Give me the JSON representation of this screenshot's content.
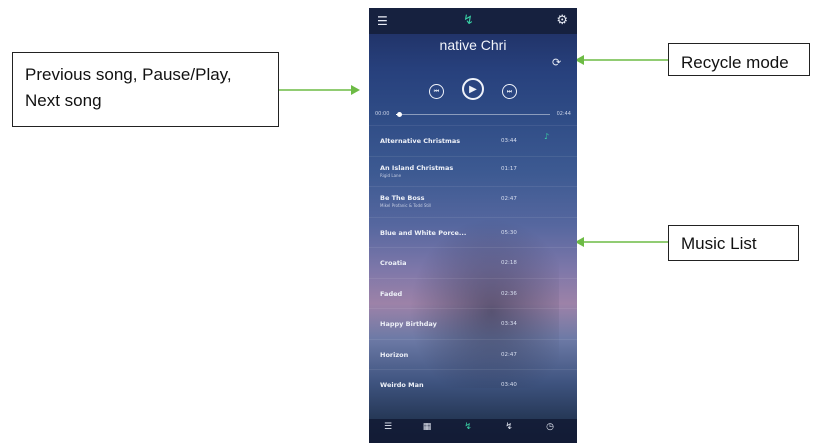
{
  "callouts": {
    "controls": {
      "line1": "Previous song, Pause/Play,",
      "line2": "Next song"
    },
    "recycle": "Recycle mode",
    "music_list": "Music List"
  },
  "player": {
    "title": "native Chri",
    "time_current": "00:00",
    "time_total": "02:44",
    "progress": 0.02
  },
  "songs": [
    {
      "name": "Alternative Christmas",
      "duration": "03:44",
      "sub": ""
    },
    {
      "name": "An Island Christmas",
      "duration": "01:17",
      "sub": "Rigid Lane"
    },
    {
      "name": "Be The Boss",
      "duration": "02:47",
      "sub": "Mikel Profanic & Todd Still"
    },
    {
      "name": "Blue and White Porce...",
      "duration": "05:30",
      "sub": ""
    },
    {
      "name": "Croatia",
      "duration": "02:18",
      "sub": ""
    },
    {
      "name": "Faded",
      "duration": "02:36",
      "sub": ""
    },
    {
      "name": "Happy Birthday",
      "duration": "03:34",
      "sub": ""
    },
    {
      "name": "Horizon",
      "duration": "02:47",
      "sub": ""
    },
    {
      "name": "Weirdo Man",
      "duration": "03:40",
      "sub": ""
    }
  ],
  "colors": {
    "accent": "#39d3a6",
    "arrow": "#6dbb45"
  },
  "icons": {
    "menu": "menu-icon",
    "logo": "waveform-icon",
    "settings": "gear-icon",
    "recycle": "recycle-icon",
    "prev": "previous-icon",
    "play": "play-icon",
    "next": "next-icon"
  }
}
